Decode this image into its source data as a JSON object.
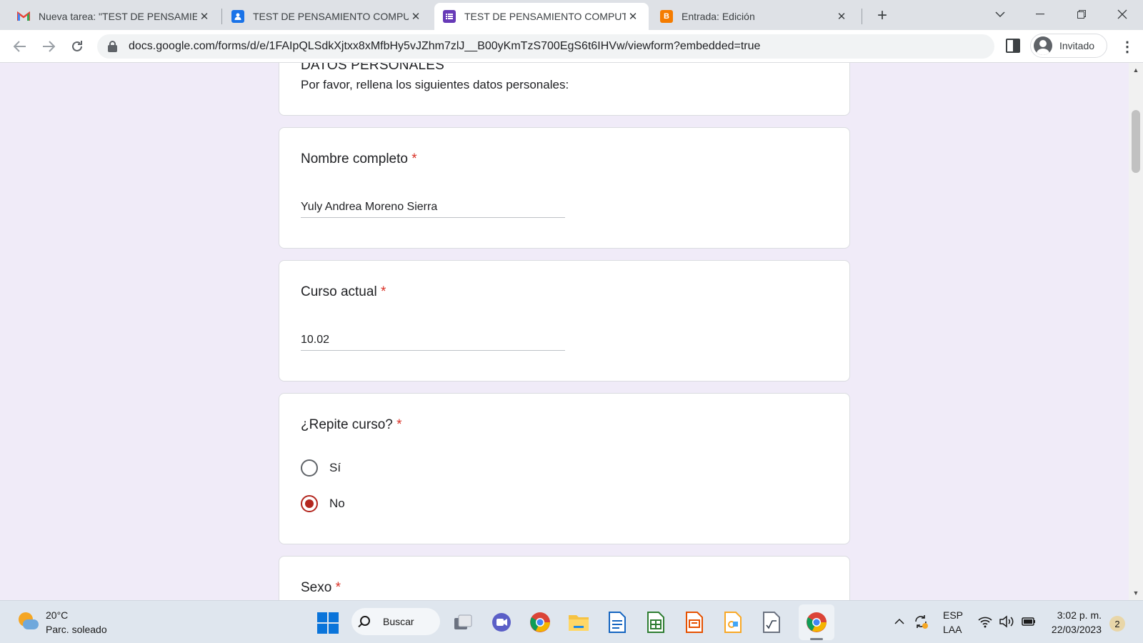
{
  "browser": {
    "tabs": [
      {
        "title": "Nueva tarea: \"TEST DE PENSAMIE",
        "favicon": "gmail-icon",
        "color": "#ea4335"
      },
      {
        "title": "TEST DE PENSAMIENTO COMPUT",
        "favicon": "classroom-icon",
        "color": "#1a73e8"
      },
      {
        "title": "TEST DE PENSAMIENTO COMPUT",
        "favicon": "forms-icon",
        "color": "#673ab7"
      },
      {
        "title": "Entrada: Edición",
        "favicon": "blogger-icon",
        "color": "#f57c00"
      }
    ],
    "active_tab_index": 2,
    "url": "docs.google.com/forms/d/e/1FAIpQLSdkXjtxx8xMfbHy5vJZhm7zlJ__B00yKmTzS700EgS6t6IHVw/viewform?embedded=true",
    "profile_label": "Invitado"
  },
  "form": {
    "section": {
      "title": "DATOS PERSONALES",
      "description": "Por favor, rellena los siguientes datos personales:"
    },
    "questions": [
      {
        "label": "Nombre completo",
        "required": "*",
        "type": "text",
        "value": "Yuly Andrea Moreno Sierra"
      },
      {
        "label": "Curso actual",
        "required": "*",
        "type": "text",
        "value": "10.02"
      },
      {
        "label": "¿Repite curso?",
        "required": "*",
        "type": "radio",
        "options": [
          "Sí",
          "No"
        ],
        "selected": "No"
      },
      {
        "label": "Sexo",
        "required": "*",
        "type": "radio"
      }
    ],
    "accent_color": "#b3261e",
    "required_color": "#d93025"
  },
  "taskbar": {
    "weather_temp": "20°C",
    "weather_desc": "Parc. soleado",
    "search_label": "Buscar",
    "language": "ESP",
    "layout": "LAA",
    "time": "3:02 p. m.",
    "date": "22/03/2023",
    "notifications": "2"
  }
}
